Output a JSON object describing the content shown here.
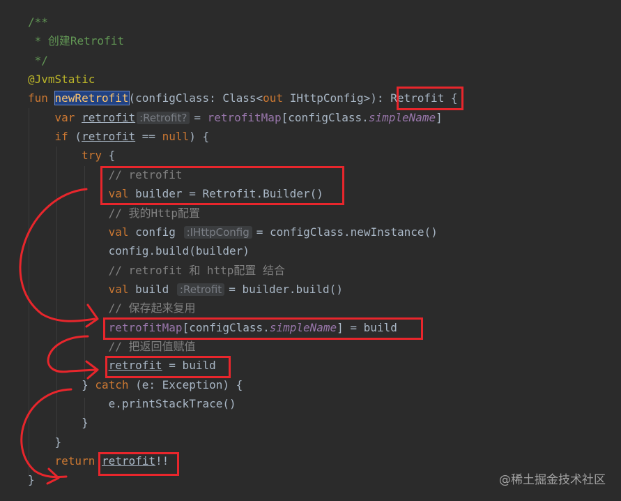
{
  "colors": {
    "background": "#2b2b2b",
    "keyword": "#cc7832",
    "comment": "#629755",
    "annotation": "#bbb529",
    "function": "#ffc66d",
    "property": "#9876aa",
    "plain": "#a9b7c6",
    "hint": "#7a7e85",
    "highlight_box": "#e8262c",
    "arrow": "#e8262c"
  },
  "code_lines": [
    {
      "tokens": [
        {
          "t": "/**",
          "c": "comment"
        }
      ]
    },
    {
      "tokens": [
        {
          "t": " * 创建Retrofit",
          "c": "comment"
        }
      ]
    },
    {
      "tokens": [
        {
          "t": " */",
          "c": "comment"
        }
      ]
    },
    {
      "tokens": [
        {
          "t": "@JvmStatic",
          "c": "annotation"
        }
      ]
    },
    {
      "tokens": [
        {
          "t": "fun ",
          "c": "keyword"
        },
        {
          "t": "newRetrofit",
          "c": "function",
          "sel": true
        },
        {
          "t": "(configClass: Class<",
          "c": "plain"
        },
        {
          "t": "out",
          "c": "keyword"
        },
        {
          "t": " IHttpConfig>): Retrofit {",
          "c": "plain"
        }
      ]
    },
    {
      "tokens": [
        {
          "t": "    ",
          "c": "plain"
        },
        {
          "t": "var ",
          "c": "keyword"
        },
        {
          "t": "retrofit",
          "c": "plain",
          "ul": true
        },
        {
          "hint": ":Retrofit?"
        },
        {
          "t": "= ",
          "c": "plain"
        },
        {
          "t": "retrofitMap",
          "c": "property"
        },
        {
          "t": "[configClass.",
          "c": "plain"
        },
        {
          "t": "simpleName",
          "c": "property",
          "i": true
        },
        {
          "t": "]",
          "c": "plain"
        }
      ]
    },
    {
      "tokens": [
        {
          "t": "    ",
          "c": "plain"
        },
        {
          "t": "if",
          "c": "keyword"
        },
        {
          "t": " (",
          "c": "plain"
        },
        {
          "t": "retrofit",
          "c": "plain",
          "ul": true
        },
        {
          "t": " == ",
          "c": "plain"
        },
        {
          "t": "null",
          "c": "keyword"
        },
        {
          "t": ") {",
          "c": "plain"
        }
      ]
    },
    {
      "tokens": [
        {
          "t": "        ",
          "c": "plain"
        },
        {
          "t": "try",
          "c": "keyword"
        },
        {
          "t": " {",
          "c": "plain"
        }
      ]
    },
    {
      "tokens": [
        {
          "t": "            // retrofit",
          "c": "hintgray"
        }
      ]
    },
    {
      "tokens": [
        {
          "t": "            ",
          "c": "plain"
        },
        {
          "t": "val ",
          "c": "keyword"
        },
        {
          "t": "builder = Retrofit.Builder()",
          "c": "plain"
        }
      ]
    },
    {
      "tokens": [
        {
          "t": "            // 我的Http配置",
          "c": "hintgray"
        }
      ]
    },
    {
      "tokens": [
        {
          "t": "            ",
          "c": "plain"
        },
        {
          "t": "val ",
          "c": "keyword"
        },
        {
          "t": "config ",
          "c": "plain"
        },
        {
          "hint": ":IHttpConfig"
        },
        {
          "t": "= configClass.newInstance()",
          "c": "plain"
        }
      ]
    },
    {
      "tokens": [
        {
          "t": "            config.build(builder)",
          "c": "plain"
        }
      ]
    },
    {
      "tokens": [
        {
          "t": "            // retrofit 和 http配置 结合",
          "c": "hintgray"
        }
      ]
    },
    {
      "tokens": [
        {
          "t": "            ",
          "c": "plain"
        },
        {
          "t": "val ",
          "c": "keyword"
        },
        {
          "t": "build ",
          "c": "plain"
        },
        {
          "hint": ":Retrofit"
        },
        {
          "t": "= builder.build()",
          "c": "plain"
        }
      ]
    },
    {
      "tokens": [
        {
          "t": "            // 保存起来复用",
          "c": "hintgray"
        }
      ]
    },
    {
      "tokens": [
        {
          "t": "            ",
          "c": "plain"
        },
        {
          "t": "retrofitMap",
          "c": "property"
        },
        {
          "t": "[configClass.",
          "c": "plain"
        },
        {
          "t": "simpleName",
          "c": "property",
          "i": true
        },
        {
          "t": "] = build",
          "c": "plain"
        }
      ]
    },
    {
      "tokens": [
        {
          "t": "            // 把返回值赋值",
          "c": "hintgray"
        }
      ]
    },
    {
      "tokens": [
        {
          "t": "            ",
          "c": "plain"
        },
        {
          "t": "retrofit",
          "c": "plain",
          "ul": true
        },
        {
          "t": " = build",
          "c": "plain"
        }
      ]
    },
    {
      "tokens": [
        {
          "t": "        } ",
          "c": "plain"
        },
        {
          "t": "catch",
          "c": "keyword"
        },
        {
          "t": " (e: Exception) {",
          "c": "plain"
        }
      ]
    },
    {
      "tokens": [
        {
          "t": "            e.printStackTrace()",
          "c": "plain"
        }
      ]
    },
    {
      "tokens": [
        {
          "t": "        }",
          "c": "plain"
        }
      ]
    },
    {
      "tokens": [
        {
          "t": "    }",
          "c": "plain"
        }
      ]
    },
    {
      "tokens": [
        {
          "t": "    ",
          "c": "plain"
        },
        {
          "t": "return ",
          "c": "keyword"
        },
        {
          "t": "retrofit",
          "c": "plain",
          "ul": true
        },
        {
          "t": "!!",
          "c": "plain"
        }
      ]
    },
    {
      "tokens": [
        {
          "t": "}",
          "c": "plain"
        }
      ]
    }
  ],
  "watermark": "@稀土掘金技术社区"
}
